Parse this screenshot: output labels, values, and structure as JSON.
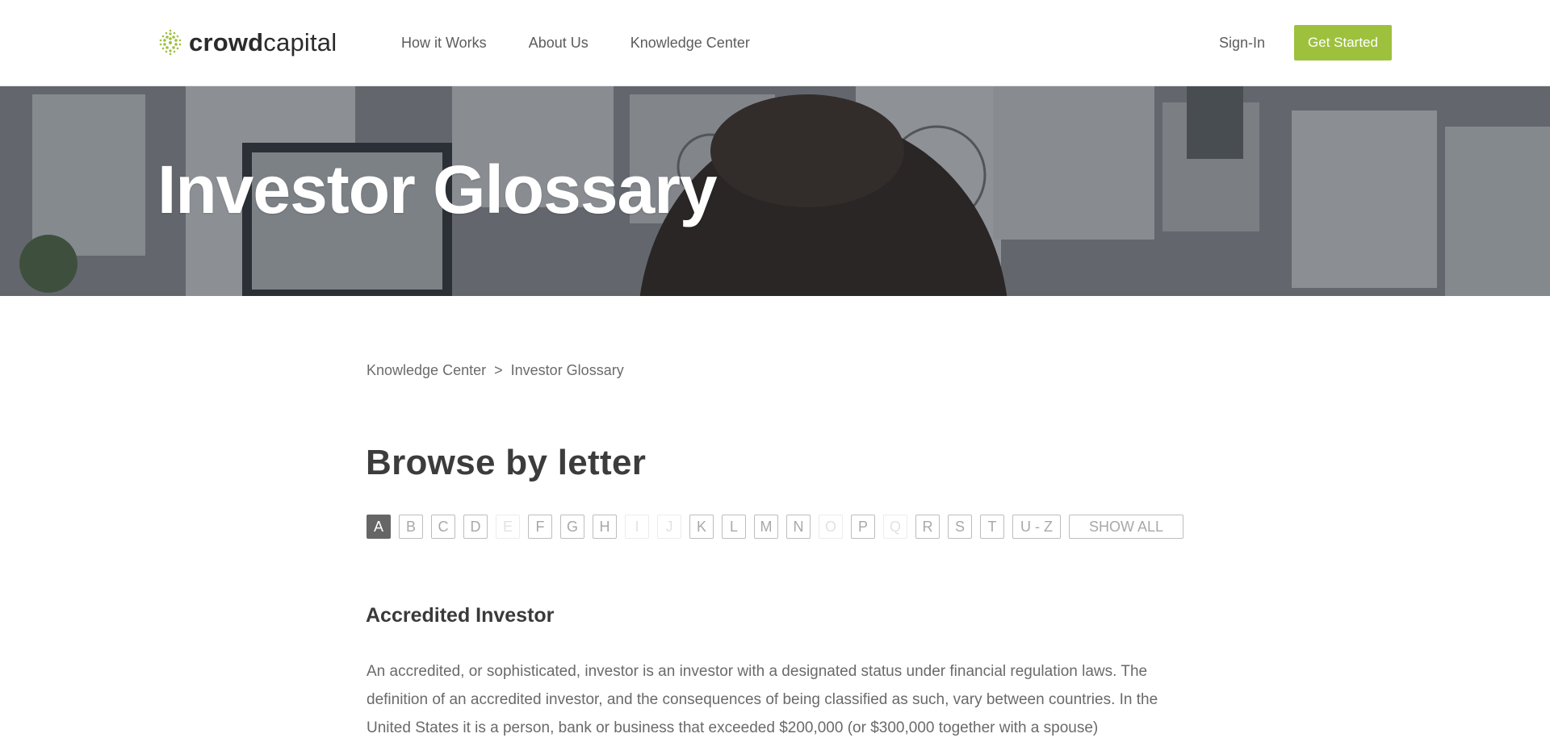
{
  "header": {
    "logo": {
      "bold": "crowd",
      "light": "capital"
    },
    "nav": [
      {
        "label": "How it Works"
      },
      {
        "label": "About Us"
      },
      {
        "label": "Knowledge Center"
      }
    ],
    "sign_in": "Sign-In",
    "get_started": "Get Started"
  },
  "hero": {
    "title": "Investor Glossary"
  },
  "breadcrumb": {
    "parent": "Knowledge Center",
    "separator": ">",
    "current": "Investor Glossary"
  },
  "browse": {
    "title": "Browse by letter",
    "letters": [
      {
        "label": "A",
        "state": "active"
      },
      {
        "label": "B",
        "state": "enabled"
      },
      {
        "label": "C",
        "state": "enabled"
      },
      {
        "label": "D",
        "state": "enabled"
      },
      {
        "label": "E",
        "state": "disabled"
      },
      {
        "label": "F",
        "state": "enabled"
      },
      {
        "label": "G",
        "state": "enabled"
      },
      {
        "label": "H",
        "state": "enabled"
      },
      {
        "label": "I",
        "state": "disabled"
      },
      {
        "label": "J",
        "state": "disabled"
      },
      {
        "label": "K",
        "state": "enabled"
      },
      {
        "label": "L",
        "state": "enabled"
      },
      {
        "label": "M",
        "state": "enabled"
      },
      {
        "label": "N",
        "state": "enabled"
      },
      {
        "label": "O",
        "state": "disabled"
      },
      {
        "label": "P",
        "state": "enabled"
      },
      {
        "label": "Q",
        "state": "disabled"
      },
      {
        "label": "R",
        "state": "enabled"
      },
      {
        "label": "S",
        "state": "enabled"
      },
      {
        "label": "T",
        "state": "enabled"
      },
      {
        "label": "U - Z",
        "state": "enabled"
      },
      {
        "label": "SHOW ALL",
        "state": "enabled"
      }
    ]
  },
  "term": {
    "title": "Accredited Investor",
    "body": "An accredited, or sophisticated, investor is an investor with a designated status under financial regulation laws. The definition of an accredited investor, and the consequences of being classified as such, vary between countries. In the United States it is a person, bank or business that exceeded $200,000 (or $300,000 together with a spouse)"
  },
  "colors": {
    "accent": "#9dc13c",
    "heading": "#3c3c3c",
    "text": "#6a6a6a",
    "active_letter": "#666666"
  }
}
